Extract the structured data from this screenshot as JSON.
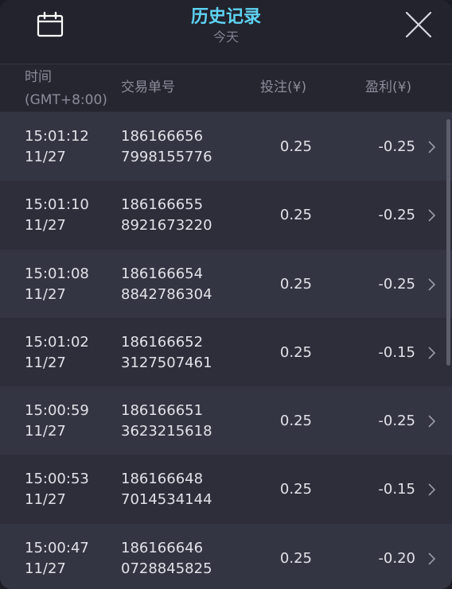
{
  "header": {
    "title": "历史记录",
    "subtitle": "今天",
    "calendar_icon": "calendar-icon",
    "close_icon": "close-icon"
  },
  "columns": {
    "time_line1": "时间",
    "time_line2": "(GMT+8:00)",
    "order_no": "交易单号",
    "bet": "投注(¥)",
    "profit": "盈利(¥)"
  },
  "records": [
    {
      "time": "15:01:12",
      "date": "11/27",
      "order_line1": "186166656",
      "order_line2": "7998155776",
      "bet": "0.25",
      "profit": "-0.25"
    },
    {
      "time": "15:01:10",
      "date": "11/27",
      "order_line1": "186166655",
      "order_line2": "8921673220",
      "bet": "0.25",
      "profit": "-0.25"
    },
    {
      "time": "15:01:08",
      "date": "11/27",
      "order_line1": "186166654",
      "order_line2": "8842786304",
      "bet": "0.25",
      "profit": "-0.25"
    },
    {
      "time": "15:01:02",
      "date": "11/27",
      "order_line1": "186166652",
      "order_line2": "3127507461",
      "bet": "0.25",
      "profit": "-0.15"
    },
    {
      "time": "15:00:59",
      "date": "11/27",
      "order_line1": "186166651",
      "order_line2": "3623215618",
      "bet": "0.25",
      "profit": "-0.25"
    },
    {
      "time": "15:00:53",
      "date": "11/27",
      "order_line1": "186166648",
      "order_line2": "7014534144",
      "bet": "0.25",
      "profit": "-0.15"
    },
    {
      "time": "15:00:47",
      "date": "11/27",
      "order_line1": "186166646",
      "order_line2": "0728845825",
      "bet": "0.25",
      "profit": "-0.20"
    }
  ],
  "colors": {
    "accent": "#5ed3f3",
    "text": "#e1e2e8",
    "muted": "#8b8c9a",
    "row_odd": "#343542",
    "row_even": "#2d2e3a"
  }
}
